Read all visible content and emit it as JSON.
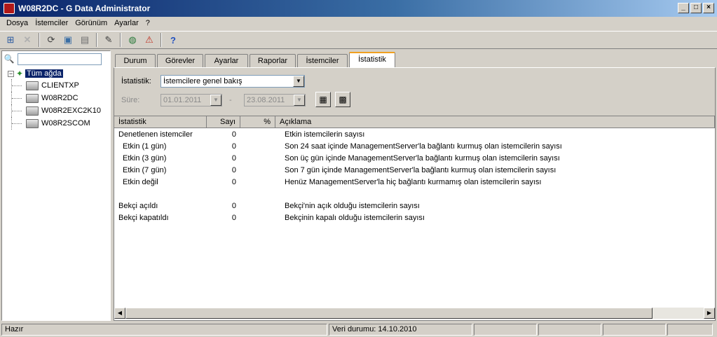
{
  "window": {
    "title": "W08R2DC - G Data Administrator"
  },
  "menu": [
    "Dosya",
    "İstemciler",
    "Görünüm",
    "Ayarlar",
    "?"
  ],
  "tree": {
    "root": "Tüm ağda",
    "children": [
      "CLIENTXP",
      "W08R2DC",
      "W08R2EXC2K10",
      "W08R2SCOM"
    ]
  },
  "tabs": [
    "Durum",
    "Görevler",
    "Ayarlar",
    "Raporlar",
    "İstemciler",
    "İstatistik"
  ],
  "active_tab": "İstatistik",
  "filters": {
    "stat_label": "İstatistik:",
    "stat_value": "İstemcilere genel bakış",
    "period_label": "Süre:",
    "from_date": "01.01.2011",
    "dash": "-",
    "to_date": "23.08.2011"
  },
  "grid": {
    "columns": [
      "İstatistik",
      "Sayı",
      "%",
      "Açıklama"
    ],
    "rows": [
      {
        "name": "Denetlenen istemciler",
        "count": "0",
        "pct": "",
        "desc": "Etkin istemcilerin sayısı",
        "indent": false
      },
      {
        "name": "Etkin (1 gün)",
        "count": "0",
        "pct": "",
        "desc": "Son 24 saat içinde ManagementServer'la bağlantı kurmuş olan istemcilerin sayısı",
        "indent": true
      },
      {
        "name": "Etkin (3 gün)",
        "count": "0",
        "pct": "",
        "desc": "Son üç gün içinde ManagementServer'la bağlantı kurmuş olan istemcilerin sayısı",
        "indent": true
      },
      {
        "name": "Etkin (7 gün)",
        "count": "0",
        "pct": "",
        "desc": "Son 7 gün içinde ManagementServer'la bağlantı kurmuş olan istemcilerin sayısı",
        "indent": true
      },
      {
        "name": "Etkin değil",
        "count": "0",
        "pct": "",
        "desc": "Henüz ManagementServer'la hiç bağlantı kurmamış olan istemcilerin sayısı",
        "indent": true
      },
      {
        "name": "",
        "count": "",
        "pct": "",
        "desc": "",
        "indent": false
      },
      {
        "name": "Bekçi açıldı",
        "count": "0",
        "pct": "",
        "desc": "Bekçi'nin açık olduğu istemcilerin sayısı",
        "indent": false
      },
      {
        "name": "Bekçi kapatıldı",
        "count": "0",
        "pct": "",
        "desc": "Bekçinin kapalı olduğu istemcilerin sayısı",
        "indent": false
      }
    ]
  },
  "status": {
    "left": "Hazır",
    "data_status": "Veri durumu: 14.10.2010"
  },
  "icons": {
    "toolbar": [
      "network-icon",
      "delete-icon",
      "refresh-icon",
      "computers-icon",
      "server-icon",
      "edit-icon",
      "globe-icon",
      "alert-icon",
      "help-icon"
    ]
  }
}
